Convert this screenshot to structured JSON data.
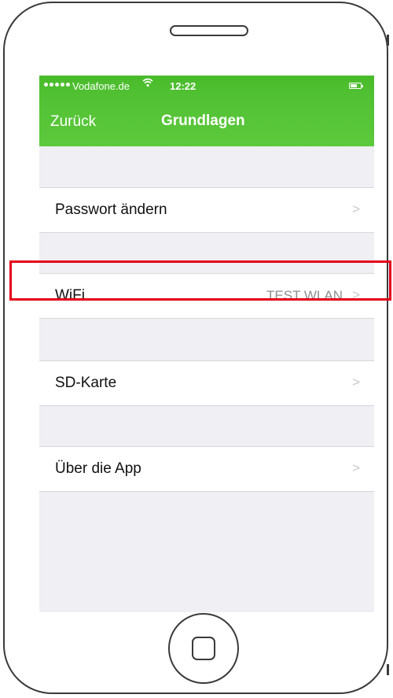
{
  "status_bar": {
    "signal_icon": "signal-dots-icon",
    "carrier": "Vodafone.de",
    "wifi_icon": "wifi-icon",
    "time": "12:22",
    "battery_icon": "battery-icon"
  },
  "nav": {
    "back_label": "Zurück",
    "title": "Grundlagen"
  },
  "settings": {
    "items": [
      {
        "label": "Passwort ändern",
        "value": "",
        "icon": "chevron-right-icon"
      },
      {
        "label": "WiFi",
        "value": "TEST WLAN",
        "icon": "chevron-right-icon"
      },
      {
        "label": "SD-Karte",
        "value": "",
        "icon": "chevron-right-icon"
      },
      {
        "label": "Über die App",
        "value": "",
        "icon": "chevron-right-icon"
      }
    ]
  },
  "colors": {
    "nav_green": "#52c234",
    "highlight_red": "#e3001b",
    "background": "#efeff4"
  }
}
